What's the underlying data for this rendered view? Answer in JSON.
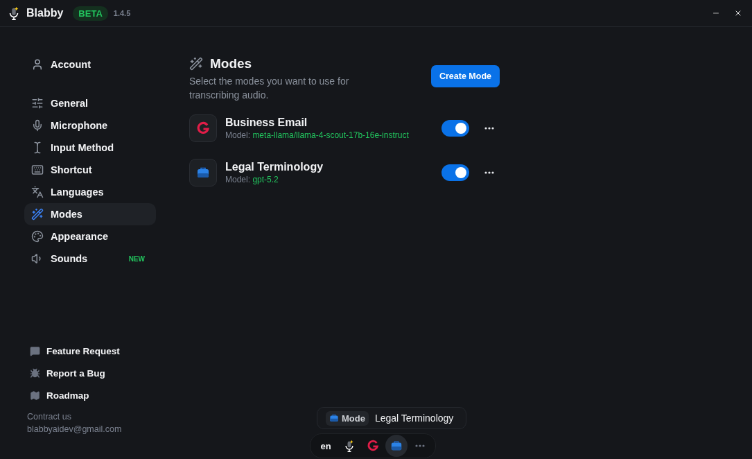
{
  "app": {
    "name": "Blabby",
    "badge": "BETA",
    "version": "1.4.5"
  },
  "sidebar": {
    "account": {
      "label": "Account",
      "selected": false
    },
    "items": [
      {
        "label": "General",
        "selected": false
      },
      {
        "label": "Microphone",
        "selected": false
      },
      {
        "label": "Input Method",
        "selected": false
      },
      {
        "label": "Shortcut",
        "selected": false
      },
      {
        "label": "Languages",
        "selected": false
      },
      {
        "label": "Modes",
        "selected": true
      },
      {
        "label": "Appearance",
        "selected": false
      },
      {
        "label": "Sounds",
        "selected": false,
        "badge": "NEW"
      }
    ],
    "links": [
      "Feature Request",
      "Report a Bug",
      "Roadmap"
    ],
    "contact": {
      "label": "Contract us",
      "email": "blabbyaidev@gmail.com"
    }
  },
  "page": {
    "title": "Modes",
    "description": "Select the modes you want to use for transcribing audio.",
    "button": "Create Mode",
    "modes": [
      {
        "kind": "g",
        "name": "Business Email",
        "model_label": "Model:",
        "model": "meta-llama/llama-4-scout-17b-16e-instruct",
        "on": true
      },
      {
        "kind": "briefcase",
        "name": "Legal Terminology",
        "model_label": "Model:",
        "model": "gpt-5.2",
        "on": true
      }
    ]
  },
  "overlay": {
    "tag": "Mode",
    "current": "Legal Terminology",
    "dock": [
      {
        "kind": "text",
        "label": "en",
        "selected": false
      },
      {
        "kind": "mic",
        "selected": false
      },
      {
        "kind": "g",
        "selected": false
      },
      {
        "kind": "briefcase",
        "selected": true
      },
      {
        "kind": "more",
        "selected": false
      }
    ]
  }
}
